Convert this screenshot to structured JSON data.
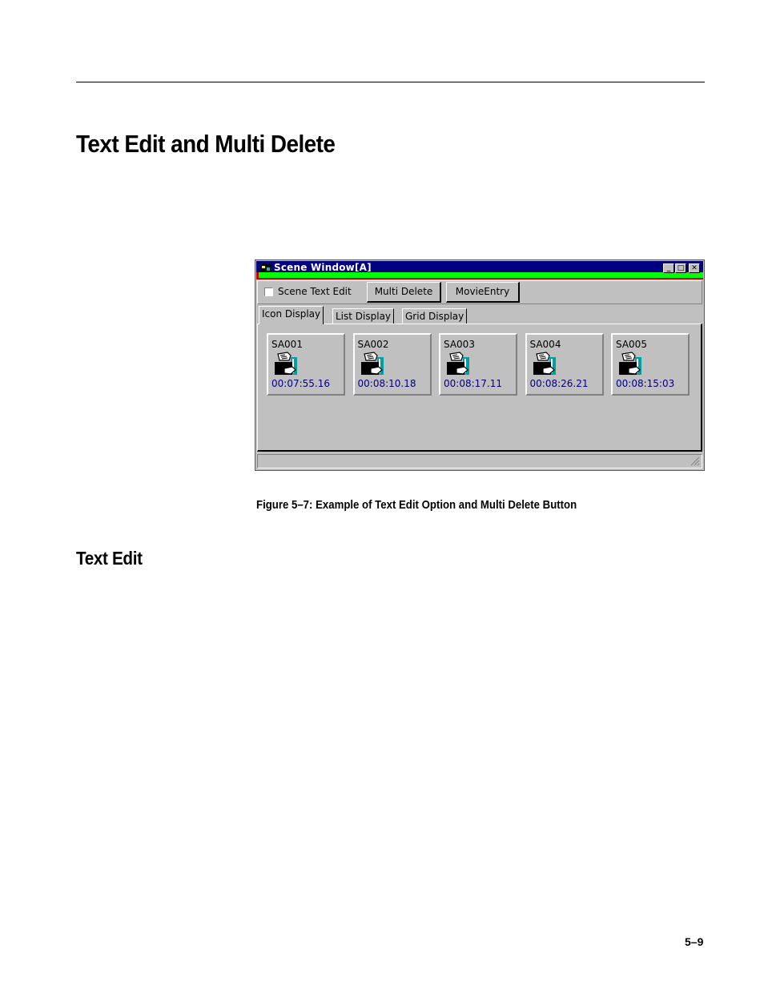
{
  "page": {
    "title": "Text Edit and Multi Delete",
    "section_heading": "Text Edit",
    "figure_caption": "Figure 5–7: Example of Text Edit Option and Multi Delete Button",
    "page_number": "5–9"
  },
  "window": {
    "title": "Scene Window[A]",
    "titlebar_color": "#000080",
    "controls": {
      "minimize": "_",
      "maximize": "□",
      "close": "✕"
    }
  },
  "toolbar": {
    "checkbox_label": "Scene Text Edit",
    "checkbox_checked": false,
    "multi_delete_label": "Multi Delete",
    "movie_entry_label": "MovieEntry"
  },
  "tabs": [
    {
      "label": "Icon Display",
      "active": true
    },
    {
      "label": "List Display",
      "active": false
    },
    {
      "label": "Grid Display",
      "active": false
    }
  ],
  "scenes": [
    {
      "name": "SA001",
      "time": "00:07:55.16"
    },
    {
      "name": "SA002",
      "time": "00:08:10.18"
    },
    {
      "name": "SA003",
      "time": "00:08:17.11"
    },
    {
      "name": "SA004",
      "time": "00:08:26.21"
    },
    {
      "name": "SA005",
      "time": "00:08:15:03"
    }
  ],
  "colors": {
    "timecode": "#000080",
    "window_face": "#c0c0c0"
  },
  "icons": {
    "scene_thumbnail": "clapper-hand-icon",
    "app": "scene-window-app-icon",
    "resize": "resize-grip-icon"
  }
}
